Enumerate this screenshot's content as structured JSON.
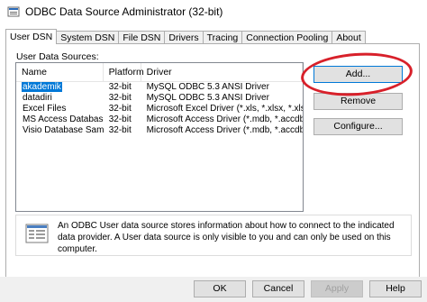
{
  "window": {
    "title": "ODBC Data Source Administrator (32-bit)"
  },
  "tabs": [
    {
      "label": "User DSN"
    },
    {
      "label": "System DSN"
    },
    {
      "label": "File DSN"
    },
    {
      "label": "Drivers"
    },
    {
      "label": "Tracing"
    },
    {
      "label": "Connection Pooling"
    },
    {
      "label": "About"
    }
  ],
  "user_dsn": {
    "section_label": "User Data Sources:",
    "columns": {
      "name": "Name",
      "platform": "Platform",
      "driver": "Driver"
    },
    "rows": [
      {
        "name": "akademik",
        "platform": "32-bit",
        "driver": "MySQL ODBC 5.3 ANSI Driver",
        "selected": true
      },
      {
        "name": "datadiri",
        "platform": "32-bit",
        "driver": "MySQL ODBC 5.3 ANSI Driver"
      },
      {
        "name": "Excel Files",
        "platform": "32-bit",
        "driver": "Microsoft Excel Driver (*.xls, *.xlsx, *.xlsm, *.xlsb)"
      },
      {
        "name": "MS Access Database",
        "platform": "32-bit",
        "driver": "Microsoft Access Driver (*.mdb, *.accdb)"
      },
      {
        "name": "Visio Database Samples",
        "platform": "32-bit",
        "driver": "Microsoft Access Driver (*.mdb, *.accdb)"
      }
    ],
    "buttons": {
      "add": "Add...",
      "remove": "Remove",
      "configure": "Configure..."
    },
    "info_text": "An ODBC User data source stores information about how to connect to the indicated data provider. A User data source is only visible to you and can only be used on this computer.",
    "info_icon": "datasource-icon"
  },
  "footer": {
    "ok": "OK",
    "cancel": "Cancel",
    "apply": "Apply",
    "help": "Help"
  },
  "colors": {
    "selection": "#0078d7",
    "annotation": "#d8202a",
    "dialog_bg": "#f0f0f0"
  }
}
